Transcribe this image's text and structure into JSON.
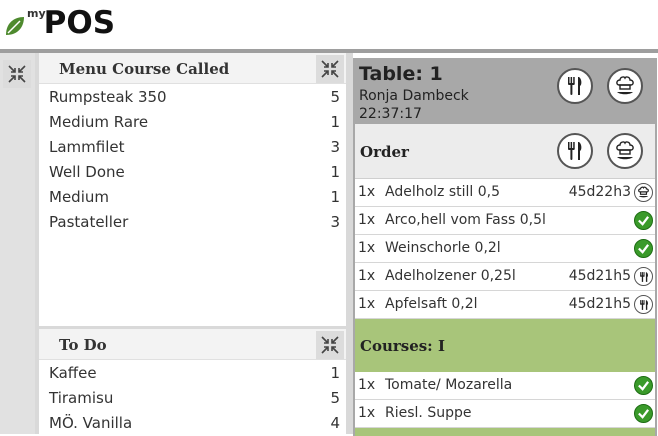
{
  "app": {
    "logo_small": "my",
    "logo_big": "POS"
  },
  "colors": {
    "leaf_green": "#4e8a2e",
    "course_green": "#a8c57a",
    "check_green": "#3a9a2a",
    "header_gray": "#a8a8a8"
  },
  "menu_course_called": {
    "title": "Menu Course Called",
    "items": [
      {
        "name": "Rumpsteak 350",
        "qty": "5"
      },
      {
        "name": "Medium Rare",
        "qty": "1"
      },
      {
        "name": "Lammfilet",
        "qty": "3"
      },
      {
        "name": "Well Done",
        "qty": "1"
      },
      {
        "name": "Medium",
        "qty": "1"
      },
      {
        "name": "Pastateller",
        "qty": "3"
      }
    ]
  },
  "todo": {
    "title": "To Do",
    "items": [
      {
        "name": "Kaffee",
        "qty": "1"
      },
      {
        "name": "Tiramisu",
        "qty": "5"
      },
      {
        "name": "MÖ. Vanilla",
        "qty": "4"
      }
    ]
  },
  "table": {
    "title": "Table: 1",
    "waiter": "Ronja Dambeck",
    "time": "22:37:17",
    "icons": [
      "cutlery-icon",
      "chef-icon"
    ]
  },
  "order": {
    "title": "Order",
    "items": [
      {
        "qty": "1x",
        "name": "Adelholz still 0,5",
        "time": "45d22h3",
        "icon": "chef-icon"
      },
      {
        "qty": "1x",
        "name": "Arco,hell vom Fass 0,5l",
        "time": "",
        "icon": "check-icon"
      },
      {
        "qty": "1x",
        "name": "Weinschorle 0,2l",
        "time": "",
        "icon": "check-icon"
      },
      {
        "qty": "1x",
        "name": "Adelholzener 0,25l",
        "time": "45d21h5",
        "icon": "cutlery-icon"
      },
      {
        "qty": "1x",
        "name": "Apfelsaft 0,2l",
        "time": "45d21h5",
        "icon": "cutlery-icon"
      }
    ]
  },
  "courses": {
    "title": "Courses: I",
    "items": [
      {
        "qty": "1x",
        "name": "Tomate/ Mozarella",
        "icon": "check-icon"
      },
      {
        "qty": "1x",
        "name": "Riesl. Suppe",
        "icon": "check-icon"
      }
    ]
  }
}
